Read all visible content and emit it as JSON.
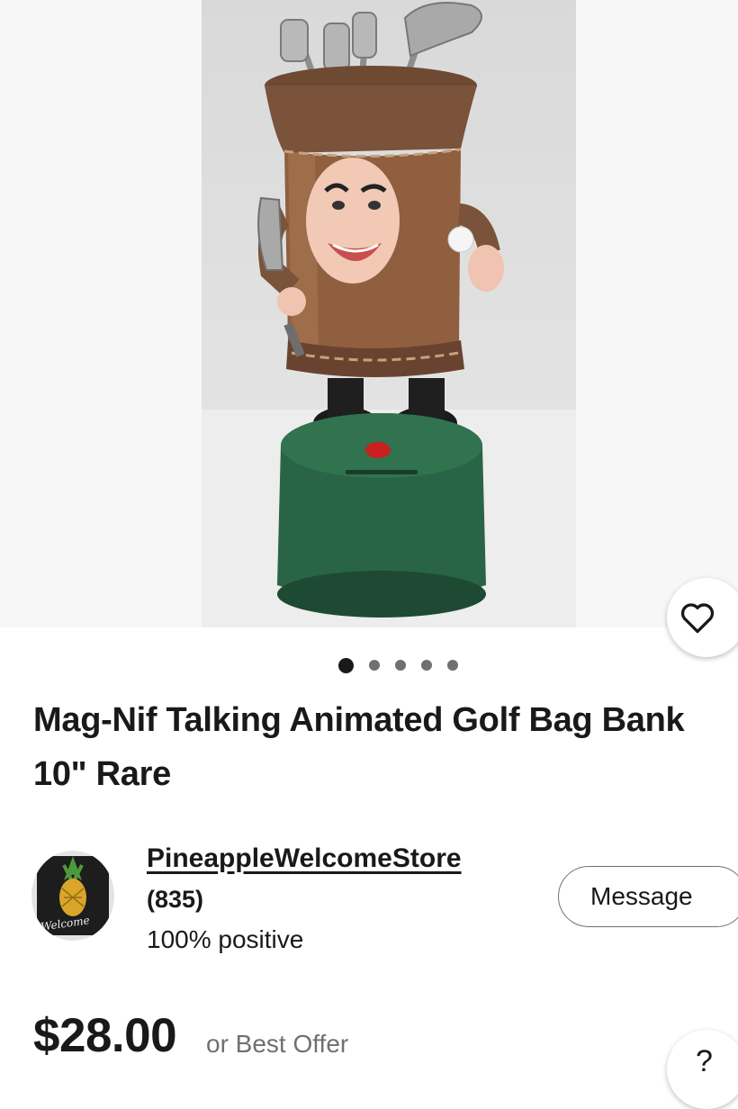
{
  "product": {
    "title": "Mag-Nif Talking Animated Golf Bag Bank 10\" Rare",
    "price": "$28.00",
    "offer_text": "or Best Offer"
  },
  "gallery": {
    "image_count": 5,
    "active_index": 0
  },
  "seller": {
    "name": "PineappleWelcomeStore",
    "feedback_count": "(835)",
    "positive_rating": "100% positive",
    "avatar_script": "Welcome"
  },
  "actions": {
    "message_label": "Message",
    "help_label": "?"
  },
  "icons": {
    "watchlist": "heart-icon",
    "help": "question-icon"
  },
  "colors": {
    "text": "#191919",
    "secondary_text": "#707070",
    "border": "#707070"
  }
}
